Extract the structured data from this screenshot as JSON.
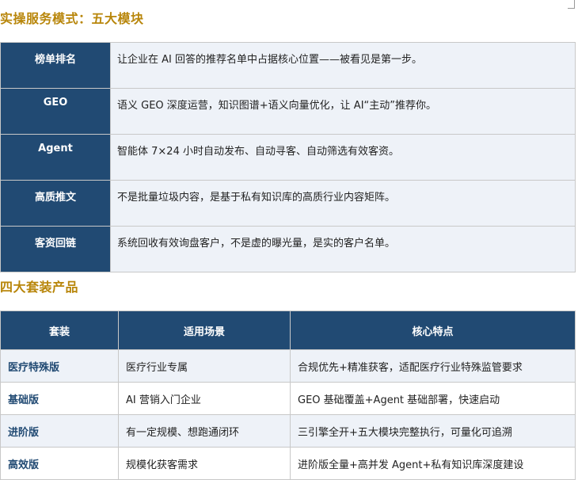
{
  "section1": {
    "title": "实操服务模式：五大模块"
  },
  "modules": [
    {
      "name": "榜单排名",
      "desc": "让企业在 AI 回答的推荐名单中占据核心位置——被看见是第一步。"
    },
    {
      "name": "GEO",
      "desc": "语义 GEO 深度运营，知识图谱+语义向量优化，让 AI“主动”推荐你。"
    },
    {
      "name": "Agent",
      "desc": "智能体 7×24 小时自动发布、自动寻客、自动筛选有效客资。"
    },
    {
      "name": "高质推文",
      "desc": "不是批量垃圾内容，是基于私有知识库的高质行业内容矩阵。"
    },
    {
      "name": "客资回链",
      "desc": "系统回收有效询盘客户，不是虚的曝光量，是实的客户名单。"
    }
  ],
  "section2": {
    "title": "四大套装产品"
  },
  "packages": {
    "headers": [
      "套装",
      "适用场景",
      "核心特点"
    ],
    "rows": [
      {
        "name": "医疗特殊版",
        "scene": "医疗行业专属",
        "feature": "合规优先+精准获客，适配医疗行业特殊监管要求"
      },
      {
        "name": "基础版",
        "scene": "AI 营销入门企业",
        "feature": "GEO 基础覆盖+Agent 基础部署，快速启动"
      },
      {
        "name": "进阶版",
        "scene": "有一定规模、想跑通闭环",
        "feature": "三引擎全开+五大模块完整执行，可量化可追溯"
      },
      {
        "name": "高效版",
        "scene": "规模化获客需求",
        "feature": "进阶版全量+高并发 Agent+私有知识库深度建设"
      }
    ]
  },
  "colors": {
    "accent_title": "#b8860b",
    "header_blue": "#214a73",
    "row_tint": "#eef2f8"
  }
}
